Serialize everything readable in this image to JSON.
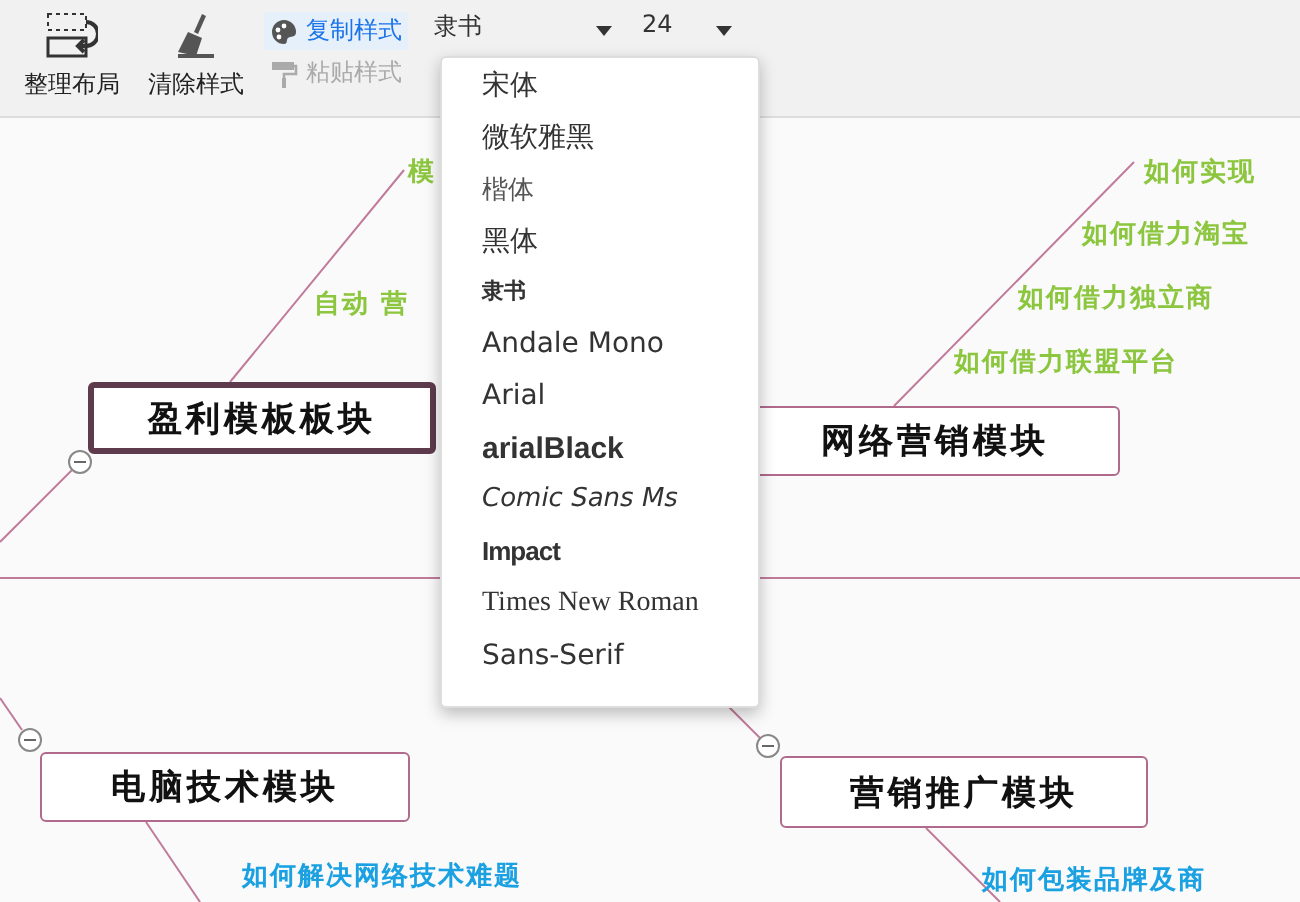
{
  "toolbar": {
    "buttons": [
      {
        "label": "整理布局",
        "kind": "layout"
      },
      {
        "label": "清除样式",
        "kind": "clear"
      }
    ],
    "style_buttons": [
      {
        "label": "复制样式",
        "kind": "copy",
        "disabled": false
      },
      {
        "label": "粘贴样式",
        "kind": "paste",
        "disabled": true
      }
    ],
    "font_select": {
      "value": "隶书"
    },
    "size_select": {
      "value": "24"
    }
  },
  "font_menu": {
    "items": [
      {
        "label": "宋体",
        "kind": "sans"
      },
      {
        "label": "微软雅黑",
        "kind": "sans"
      },
      {
        "label": "楷体",
        "kind": "light"
      },
      {
        "label": "黑体",
        "kind": "sans"
      },
      {
        "label": "隶书",
        "kind": "small"
      },
      {
        "label": "Andale Mono",
        "kind": "sans"
      },
      {
        "label": "Arial",
        "kind": "sans"
      },
      {
        "label": "arialBlack",
        "kind": "black"
      },
      {
        "label": "Comic Sans Ms",
        "kind": "italic"
      },
      {
        "label": "Impact",
        "kind": "condensed"
      },
      {
        "label": "Times New Roman",
        "kind": "serif"
      },
      {
        "label": "Sans-Serif",
        "kind": "sans"
      }
    ]
  },
  "mind_map": {
    "nodes": [
      {
        "label": "盈利模板板块",
        "selected": true,
        "collapsible": true
      },
      {
        "label": "网络营销模块",
        "selected": false,
        "collapsible": false
      },
      {
        "label": "电脑技术模块",
        "selected": false,
        "collapsible": true
      },
      {
        "label": "营销推广模块",
        "selected": false,
        "collapsible": true
      }
    ],
    "topics": [
      {
        "label": "模",
        "color": "#8cc63f"
      },
      {
        "label": "自动 营",
        "color": "#8cc63f"
      },
      {
        "label": "如何实现",
        "color": "#8cc63f"
      },
      {
        "label": "如何借力淘宝",
        "color": "#8cc63f"
      },
      {
        "label": "如何借力独立商",
        "color": "#8cc63f"
      },
      {
        "label": "如何借力联盟平台",
        "color": "#8cc63f"
      },
      {
        "label": "如何解决网络技术难题",
        "color": "#1ba1e2"
      },
      {
        "label": "如何包装品牌及商",
        "color": "#1ba1e2"
      }
    ]
  }
}
